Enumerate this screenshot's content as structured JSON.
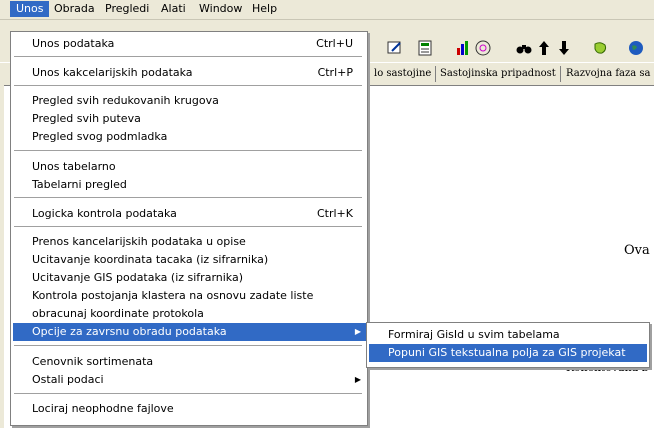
{
  "menubar": {
    "items": [
      "Unos",
      "Obrada",
      "Pregledi",
      "Alati",
      "Window",
      "Help"
    ]
  },
  "toolbar": {
    "icons": [
      "pen-icon",
      "calc-icon",
      "chart-icon",
      "target-icon",
      "binoculars-icon",
      "arrow-up-icon",
      "arrow-down-icon",
      "map-icon",
      "globe-icon"
    ]
  },
  "columns": [
    "lo sastojine",
    "Sastojinska pripadnost",
    "Razvojna faza sa"
  ],
  "content": {
    "text_ova": "Ova",
    "text_konektovana": "Konektovana b"
  },
  "unos_menu": {
    "items": [
      {
        "label": "Unos podataka",
        "shortcut": "Ctrl+U"
      },
      {
        "label": "Unos kakcelarijskih podataka",
        "shortcut": "Ctrl+P"
      },
      {
        "label": "Pregled svih redukovanih krugova",
        "shortcut": ""
      },
      {
        "label": "Pregled svih puteva",
        "shortcut": ""
      },
      {
        "label": "Pregled svog podmladka",
        "shortcut": ""
      },
      {
        "label": "Unos tabelarno",
        "shortcut": ""
      },
      {
        "label": "Tabelarni pregled",
        "shortcut": ""
      },
      {
        "label": "Logicka kontrola podataka",
        "shortcut": "Ctrl+K"
      },
      {
        "label": "Prenos kancelarijskih podataka u opise",
        "shortcut": ""
      },
      {
        "label": "Ucitavanje koordinata tacaka (iz sifrarnika)",
        "shortcut": ""
      },
      {
        "label": "Ucitavanje GIS podataka (iz sifrarnika)",
        "shortcut": ""
      },
      {
        "label": "Kontrola postojanja klastera na osnovu zadate liste",
        "shortcut": ""
      },
      {
        "label": "obracunaj koordinate protokola",
        "shortcut": ""
      },
      {
        "label": "Opcije za zavrsnu obradu podataka",
        "shortcut": ""
      },
      {
        "label": "Cenovnik sortimenata",
        "shortcut": ""
      },
      {
        "label": "Ostali podaci",
        "shortcut": ""
      },
      {
        "label": "Lociraj neophodne fajlove",
        "shortcut": ""
      }
    ]
  },
  "submenu": {
    "items": [
      {
        "label": "Formiraj GisId u svim tabelama"
      },
      {
        "label": "Popuni GIS tekstualna polja za GIS projekat"
      }
    ]
  },
  "colors": {
    "highlight": "#316ac5",
    "chrome": "#ece9d8"
  }
}
